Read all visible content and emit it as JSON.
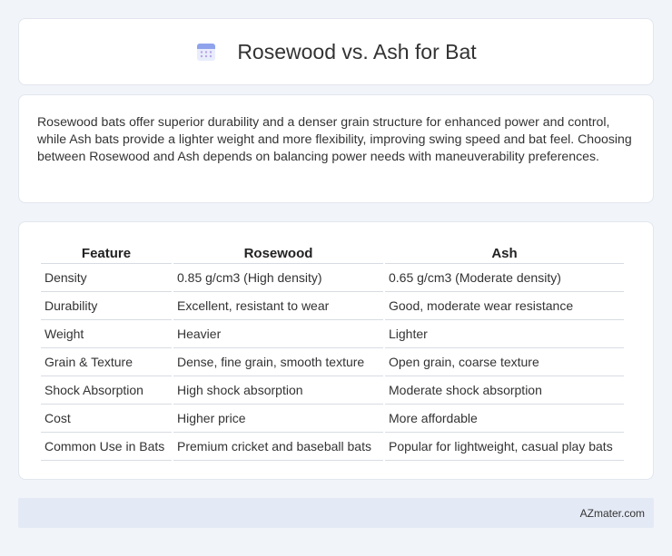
{
  "header": {
    "title": "Rosewood vs. Ash for Bat",
    "icon": "calendar-icon"
  },
  "intro": {
    "text": "Rosewood bats offer superior durability and a denser grain structure for enhanced power and control, while Ash bats provide a lighter weight and more flexibility, improving swing speed and bat feel. Choosing between Rosewood and Ash depends on balancing power needs with maneuverability preferences."
  },
  "table": {
    "headers": [
      "Feature",
      "Rosewood",
      "Ash"
    ],
    "rows": [
      [
        "Density",
        "0.85 g/cm3 (High density)",
        "0.65 g/cm3 (Moderate density)"
      ],
      [
        "Durability",
        "Excellent, resistant to wear",
        "Good, moderate wear resistance"
      ],
      [
        "Weight",
        "Heavier",
        "Lighter"
      ],
      [
        "Grain & Texture",
        "Dense, fine grain, smooth texture",
        "Open grain, coarse texture"
      ],
      [
        "Shock Absorption",
        "High shock absorption",
        "Moderate shock absorption"
      ],
      [
        "Cost",
        "Higher price",
        "More affordable"
      ],
      [
        "Common Use in Bats",
        "Premium cricket and baseball bats",
        "Popular for lightweight, casual play bats"
      ]
    ]
  },
  "footer": {
    "text": "AZmater.com"
  },
  "colors": {
    "background": "#f1f4f9",
    "card": "#ffffff",
    "footer_bg": "#e4eaf5",
    "icon_accent": "#7b8fe0"
  }
}
